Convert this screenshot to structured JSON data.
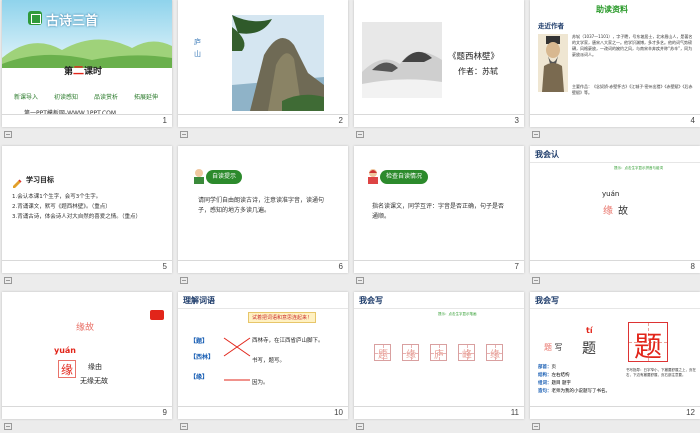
{
  "slides": [
    {
      "num": "1",
      "title": "古诗三首",
      "unit_pre": "第",
      "unit_num": "二",
      "unit_post": "课时",
      "tags": [
        "新课导入",
        "初读感知",
        "品读赏析",
        "拓展延伸"
      ],
      "footer": "第一PPT模板网-WWW.1PPT.COM"
    },
    {
      "num": "2",
      "caption": "庐  山"
    },
    {
      "num": "3",
      "poem": "《题西林壁》",
      "author": "作者：苏轼"
    },
    {
      "num": "4",
      "header": "助读资料",
      "label": "走近作者",
      "bio": "苏轼（1037—1101），字子瞻，号东坡居士，北宋眉山人，是著名的文学家，唐宋八大家之一。他学识渊博，多才多艺。他的词气势磅礴，风格豪放，一改词的婉约之风，与南宋辛弃疾并称“苏辛”，同为豪放派词人。",
      "works": "主要作品：《念奴娇·赤壁怀古》《江城子·密州出猎》《赤壁赋》《后赤壁赋》等。"
    },
    {
      "num": "5",
      "heading": "学习目标",
      "goals": [
        "1.会认本课1个生字，会写3个生字。",
        "2.背诵课文，默写《题西林壁》。（重点）",
        "3.背诵古诗，体会诗人对大自然的喜爱之情。（重点）"
      ]
    },
    {
      "num": "6",
      "pill": "自读提示",
      "text": "请同学们自由朗读古诗，注意读准字音，读通句子，感知的地方多读几遍。"
    },
    {
      "num": "7",
      "pill": "检查自读情况",
      "text": "指名读课文，同学互评：字音是否正确，句子是否通顺。"
    },
    {
      "num": "8",
      "label": "我会认",
      "note": "提示：点击生字显示拼音与组词",
      "pinyin": "yuán",
      "char1": "缘",
      "char2": "故"
    },
    {
      "num": "9",
      "line1": "缘故",
      "pinyin": "yuán",
      "char": "缘",
      "word1": "缘由",
      "word2": "无缘无故"
    },
    {
      "num": "10",
      "label": "理解词语",
      "banner": "试着把词语和意思连起来！",
      "words": [
        "【题】",
        "【西林】",
        "【缘】"
      ],
      "meanings": [
        "西林寺，在江西省庐山脚下。",
        "书写，题写。",
        "因为。"
      ]
    },
    {
      "num": "11",
      "label": "我会写",
      "note": "提示：点击生字显示笔画",
      "chars": [
        "题",
        "缘",
        "庐",
        "峰",
        "缘"
      ]
    },
    {
      "num": "12",
      "label": "我会写",
      "pinyin": "tí",
      "char": "题",
      "strip_red": "题",
      "strip_black": "写",
      "big_char": "题",
      "info": [
        [
          "部首：",
          "页"
        ],
        [
          "结构：",
          "左右结构"
        ],
        [
          "组词：",
          "题目  题字"
        ],
        [
          "造句：",
          "老师为我的小说题写了书名。"
        ]
      ],
      "tip": "书写指导：日字窄小，下撇要舒展之上，页在右，下边有撇要舒展，页右部注意要。"
    }
  ]
}
